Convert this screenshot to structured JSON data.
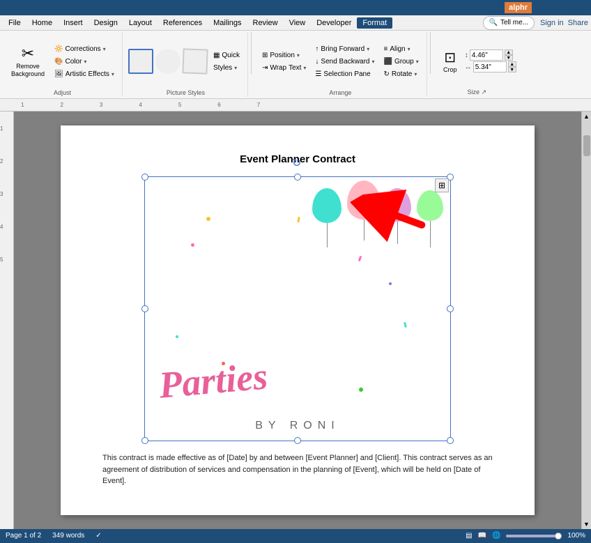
{
  "titlebar": {
    "brand": "alphr",
    "signin": "Sign in",
    "share": "Share"
  },
  "menubar": {
    "items": [
      "File",
      "Home",
      "Insert",
      "Design",
      "Layout",
      "References",
      "Mailings",
      "Review",
      "View",
      "Developer",
      "Format"
    ]
  },
  "ribbon": {
    "active_tab": "Format",
    "groups": {
      "adjust": {
        "label": "Adjust",
        "buttons": {
          "remove_bg": "Remove Background",
          "corrections": "Corrections",
          "color": "Color",
          "artistic_effects": "Artistic Effects"
        }
      },
      "picture_styles": {
        "label": "Picture Styles"
      },
      "arrange": {
        "label": "Arrange",
        "buttons": {
          "position": "Position",
          "wrap_text": "Wrap Text",
          "bring_forward": "Bring Forward",
          "send_backward": "Send Backward",
          "selection_pane": "Selection Pane"
        }
      },
      "size": {
        "label": "Size",
        "width": "4.46\"",
        "height": "5.34\"",
        "crop": "Crop"
      }
    }
  },
  "tell_me": "Tell me...",
  "document": {
    "title": "Event Planner Contract",
    "body_text": "This contract is made effective as of [Date] by and between [Event Planner] and [Client]. This contract serves as an agreement of distribution of services and compensation in the planning of [Event], which will be held on [Date of Event].",
    "logo": {
      "text_cursive": "Parties",
      "text_sub": "BY RONI"
    }
  },
  "statusbar": {
    "page": "Page 1 of 2",
    "words": "349 words",
    "zoom": "100%",
    "view_icons": [
      "print",
      "read",
      "web"
    ]
  },
  "icons": {
    "rotate": "↻",
    "layout": "⊞",
    "corrections": "🔆",
    "color": "🎨",
    "artistic": "🖼",
    "remove_bg": "✂",
    "quick_styles": "▦",
    "position": "☰",
    "wrap": "⇥",
    "forward": "▲",
    "backward": "▼",
    "crop": "⊡",
    "search": "🔍",
    "scrollup": "▲",
    "scrolldown": "▼"
  }
}
